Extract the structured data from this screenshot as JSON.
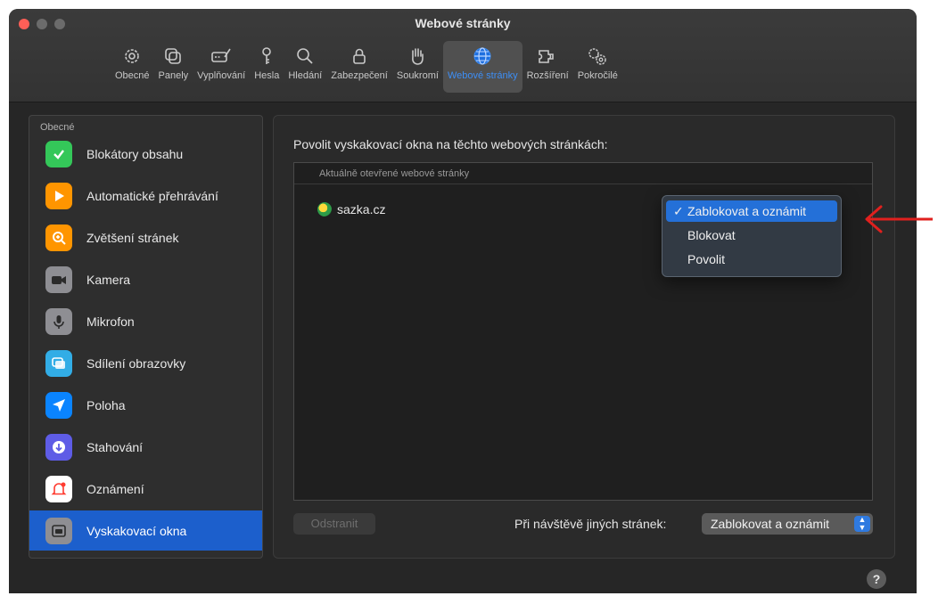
{
  "window": {
    "title": "Webové stránky"
  },
  "toolbar": {
    "tabs": [
      {
        "label": "Obecné",
        "icon": "gear-icon"
      },
      {
        "label": "Panely",
        "icon": "tabs-icon"
      },
      {
        "label": "Vyplňování",
        "icon": "autofill-icon"
      },
      {
        "label": "Hesla",
        "icon": "key-icon"
      },
      {
        "label": "Hledání",
        "icon": "search-icon"
      },
      {
        "label": "Zabezpečení",
        "icon": "lock-icon"
      },
      {
        "label": "Soukromí",
        "icon": "hand-icon"
      },
      {
        "label": "Webové stránky",
        "icon": "globe-icon",
        "active": true
      },
      {
        "label": "Rozšíření",
        "icon": "extension-icon"
      },
      {
        "label": "Pokročilé",
        "icon": "advanced-gears-icon"
      }
    ]
  },
  "sidebar": {
    "section_label": "Obecné",
    "items": [
      {
        "label": "Blokátory obsahu",
        "icon": "checkmark-shield-icon",
        "color": "#34c759"
      },
      {
        "label": "Automatické přehrávání",
        "icon": "play-icon",
        "color": "#ff9500"
      },
      {
        "label": "Zvětšení stránek",
        "icon": "zoom-icon",
        "color": "#ff9500"
      },
      {
        "label": "Kamera",
        "icon": "camera-icon",
        "color": "#8e8e93"
      },
      {
        "label": "Mikrofon",
        "icon": "microphone-icon",
        "color": "#8e8e93"
      },
      {
        "label": "Sdílení obrazovky",
        "icon": "screen-share-icon",
        "color": "#32ade6"
      },
      {
        "label": "Poloha",
        "icon": "location-arrow-icon",
        "color": "#0a84ff"
      },
      {
        "label": "Stahování",
        "icon": "download-icon",
        "color": "#5e5ce6"
      },
      {
        "label": "Oznámení",
        "icon": "bell-icon",
        "color": "#ffffff"
      },
      {
        "label": "Vyskakovací okna",
        "icon": "popup-window-icon",
        "color": "#8e8e93",
        "active": true
      }
    ]
  },
  "panel": {
    "title": "Povolit vyskakovací okna na těchto webových stránkách:",
    "list_header": "Aktuálně otevřené webové stránky",
    "site": "sazka.cz",
    "dropdown": {
      "options": [
        "Zablokovat a oznámit",
        "Blokovat",
        "Povolit"
      ],
      "selected": "Zablokovat a oznámit",
      "check_mark": "✓"
    },
    "remove_button": "Odstranit",
    "other_sites_label": "Při návštěvě jiných stránek:",
    "other_sites_value": "Zablokovat a oznámit"
  },
  "help": {
    "label": "?"
  },
  "colors": {
    "accent": "#2470d8",
    "annotation_arrow": "#e0201e"
  }
}
